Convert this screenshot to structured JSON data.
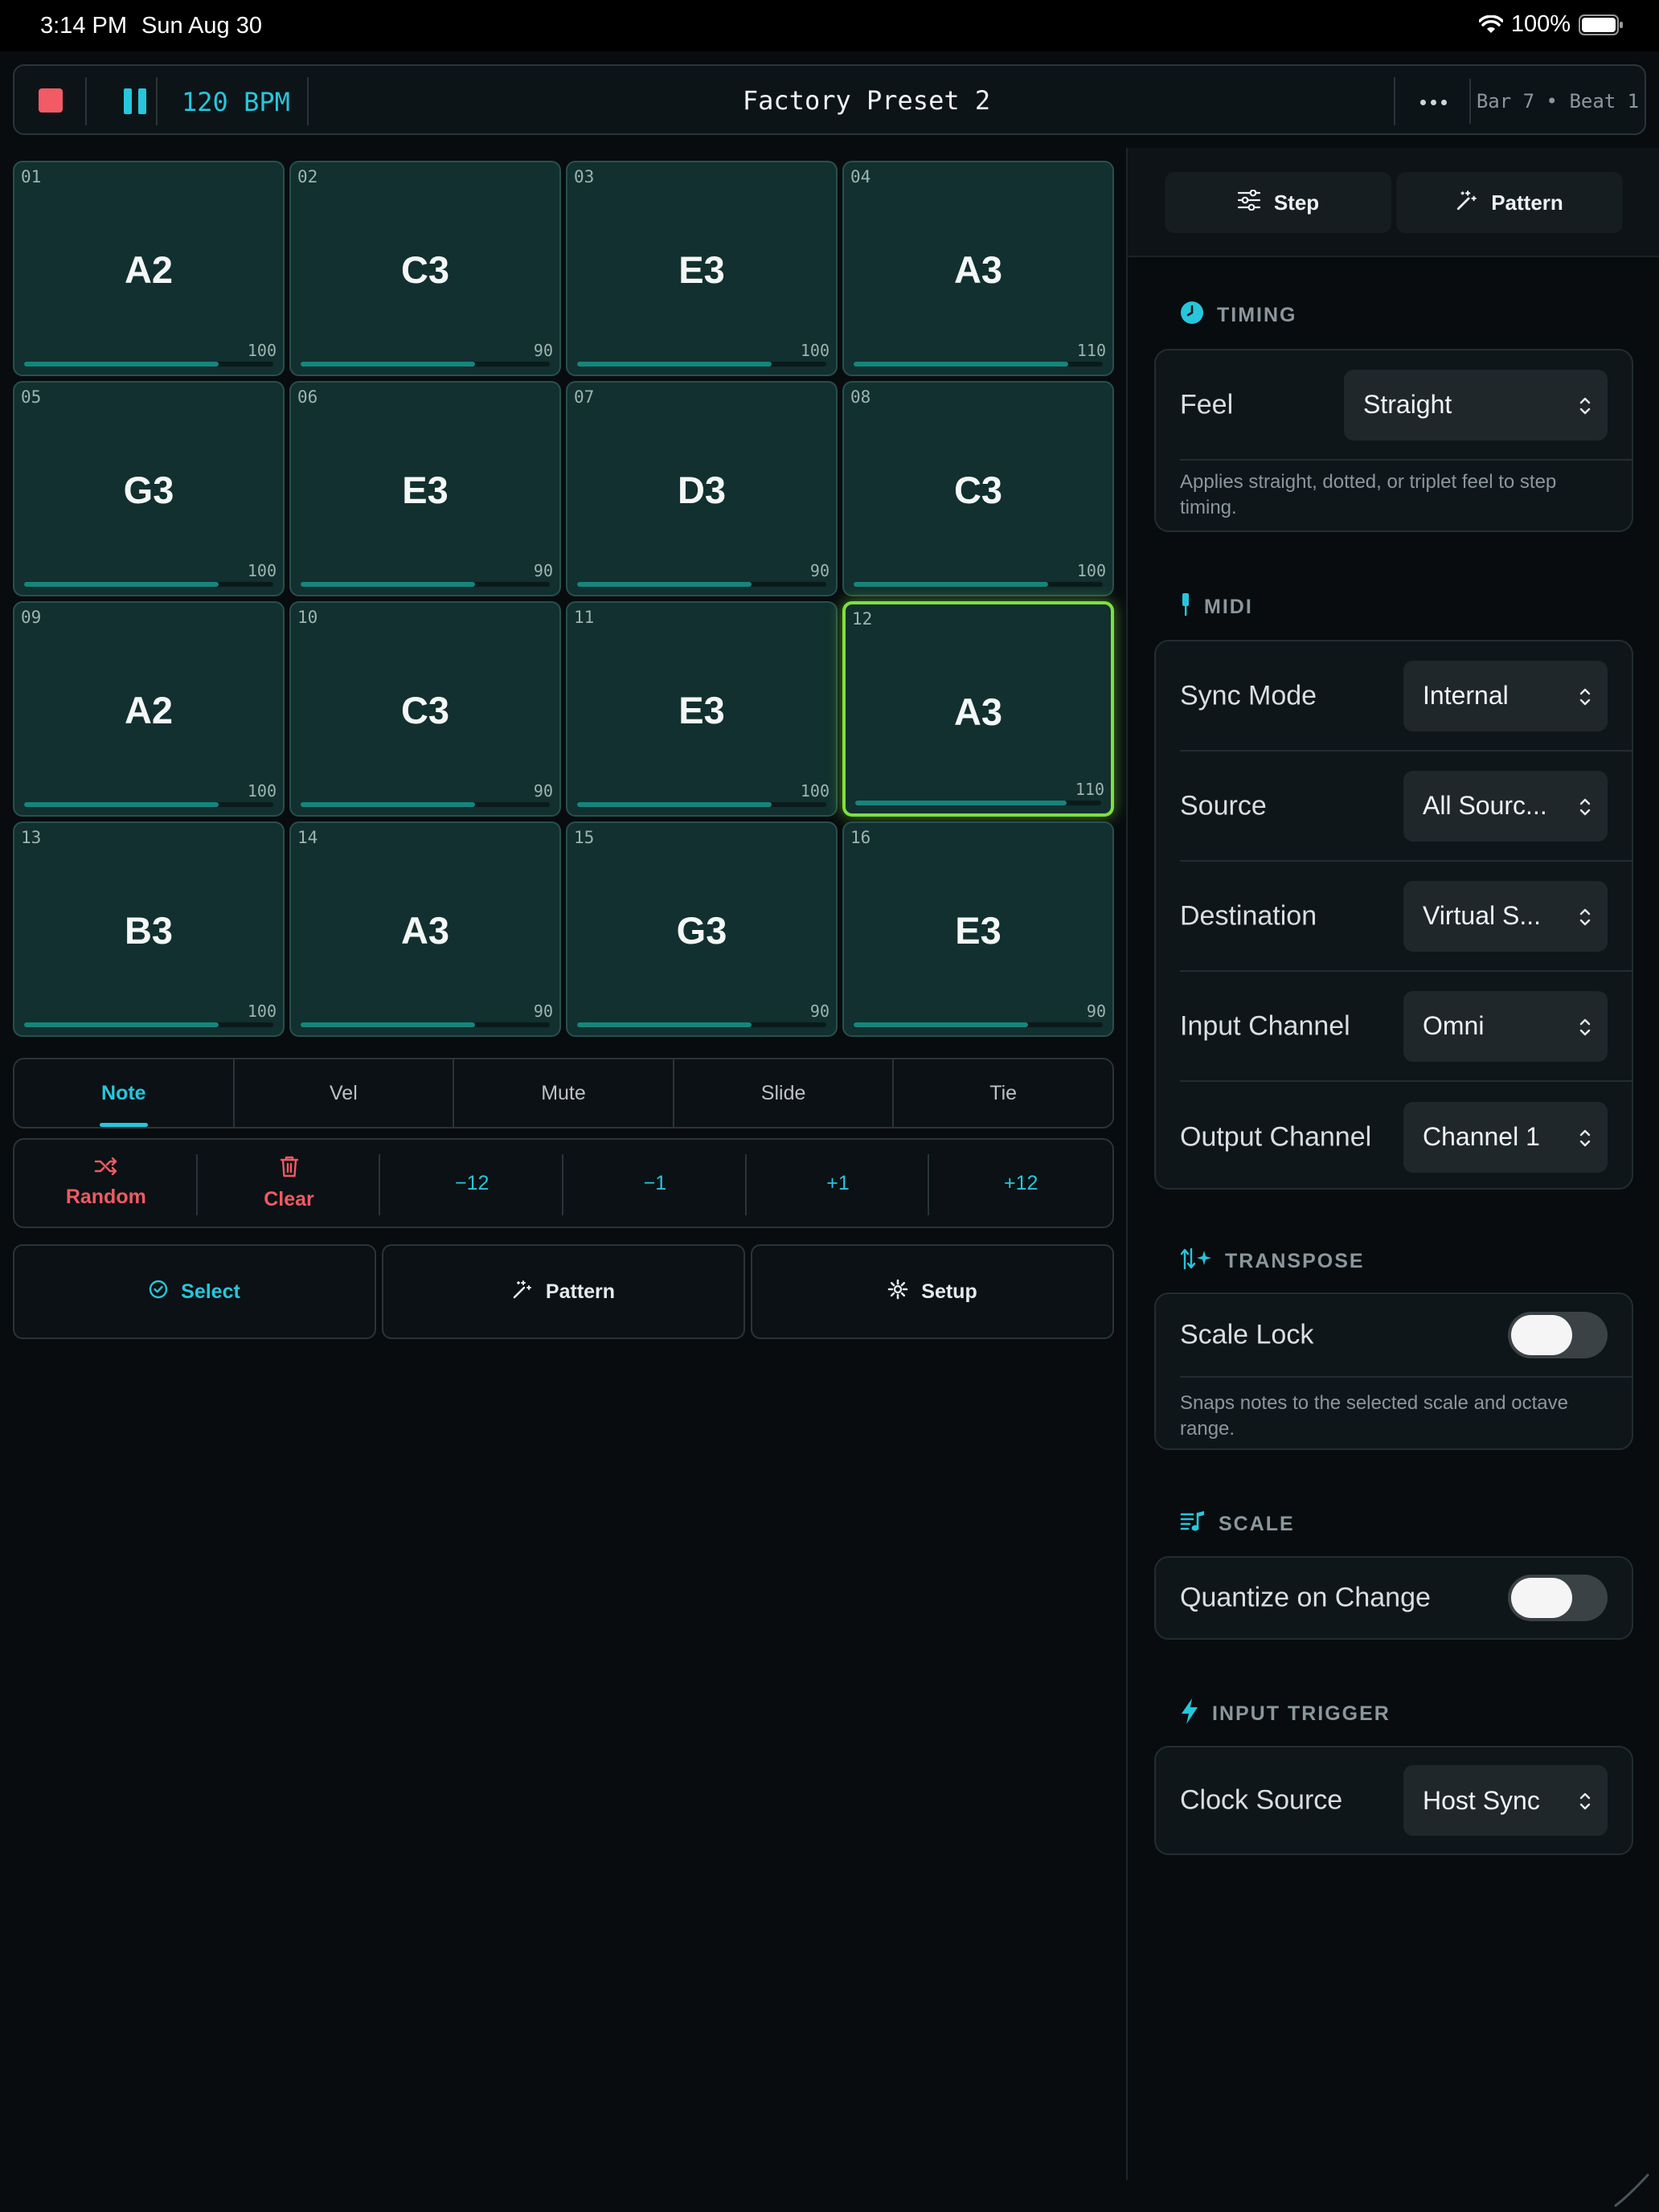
{
  "status_bar": {
    "time": "3:14 PM",
    "date": "Sun Aug 30",
    "battery": "100%"
  },
  "transport": {
    "tempo": "120 BPM",
    "preset_name": "Factory Preset 2",
    "position": "Bar 7 • Beat 1"
  },
  "steps": [
    {
      "num": "01",
      "note": "A2",
      "velocity": "100",
      "level": 0.78
    },
    {
      "num": "02",
      "note": "C3",
      "velocity": "90",
      "level": 0.7
    },
    {
      "num": "03",
      "note": "E3",
      "velocity": "100",
      "level": 0.78
    },
    {
      "num": "04",
      "note": "A3",
      "velocity": "110",
      "level": 0.86
    },
    {
      "num": "05",
      "note": "G3",
      "velocity": "100",
      "level": 0.78
    },
    {
      "num": "06",
      "note": "E3",
      "velocity": "90",
      "level": 0.7
    },
    {
      "num": "07",
      "note": "D3",
      "velocity": "90",
      "level": 0.7
    },
    {
      "num": "08",
      "note": "C3",
      "velocity": "100",
      "level": 0.78
    },
    {
      "num": "09",
      "note": "A2",
      "velocity": "100",
      "level": 0.78
    },
    {
      "num": "10",
      "note": "C3",
      "velocity": "90",
      "level": 0.7
    },
    {
      "num": "11",
      "note": "E3",
      "velocity": "100",
      "level": 0.78
    },
    {
      "num": "12",
      "note": "A3",
      "velocity": "110",
      "level": 0.86,
      "selected": true
    },
    {
      "num": "13",
      "note": "B3",
      "velocity": "100",
      "level": 0.78
    },
    {
      "num": "14",
      "note": "A3",
      "velocity": "90",
      "level": 0.7
    },
    {
      "num": "15",
      "note": "G3",
      "velocity": "90",
      "level": 0.7
    },
    {
      "num": "16",
      "note": "E3",
      "velocity": "90",
      "level": 0.7
    }
  ],
  "edit_tabs": [
    "Note",
    "Vel",
    "Mute",
    "Slide",
    "Tie"
  ],
  "active_edit_tab": "Note",
  "actions": {
    "random": "Random",
    "clear": "Clear",
    "minus12": "−12",
    "minus1": "−1",
    "plus1": "+1",
    "plus12": "+12"
  },
  "bottom_buttons": {
    "select": "Select",
    "pattern": "Pattern",
    "setup": "Setup"
  },
  "inspector_tabs": {
    "step": "Step",
    "pattern": "Pattern"
  },
  "timing": {
    "header": "TIMING",
    "feel_label": "Feel",
    "feel_value": "Straight",
    "note": "Applies straight, dotted, or triplet feel to step timing."
  },
  "midi": {
    "header": "MIDI",
    "rows": [
      {
        "label": "Sync Mode",
        "value": "Internal"
      },
      {
        "label": "Source",
        "value": "All Sourc..."
      },
      {
        "label": "Destination",
        "value": "Virtual S..."
      },
      {
        "label": "Input Channel",
        "value": "Omni"
      },
      {
        "label": "Output Channel",
        "value": "Channel 1"
      }
    ]
  },
  "transpose": {
    "header": "TRANSPOSE",
    "scale_lock_label": "Scale Lock",
    "scale_lock_on": false,
    "note": "Snaps notes to the selected scale and octave range."
  },
  "scale": {
    "header": "SCALE",
    "quantize_label": "Quantize on Change",
    "quantize_on": false
  },
  "input_trigger": {
    "header": "INPUT TRIGGER",
    "clock_label": "Clock Source",
    "clock_value": "Host Sync"
  },
  "colors": {
    "accent": "#27c6dc",
    "danger": "#ef5a63",
    "selected": "#7fe03e",
    "pad": "#11302f"
  }
}
